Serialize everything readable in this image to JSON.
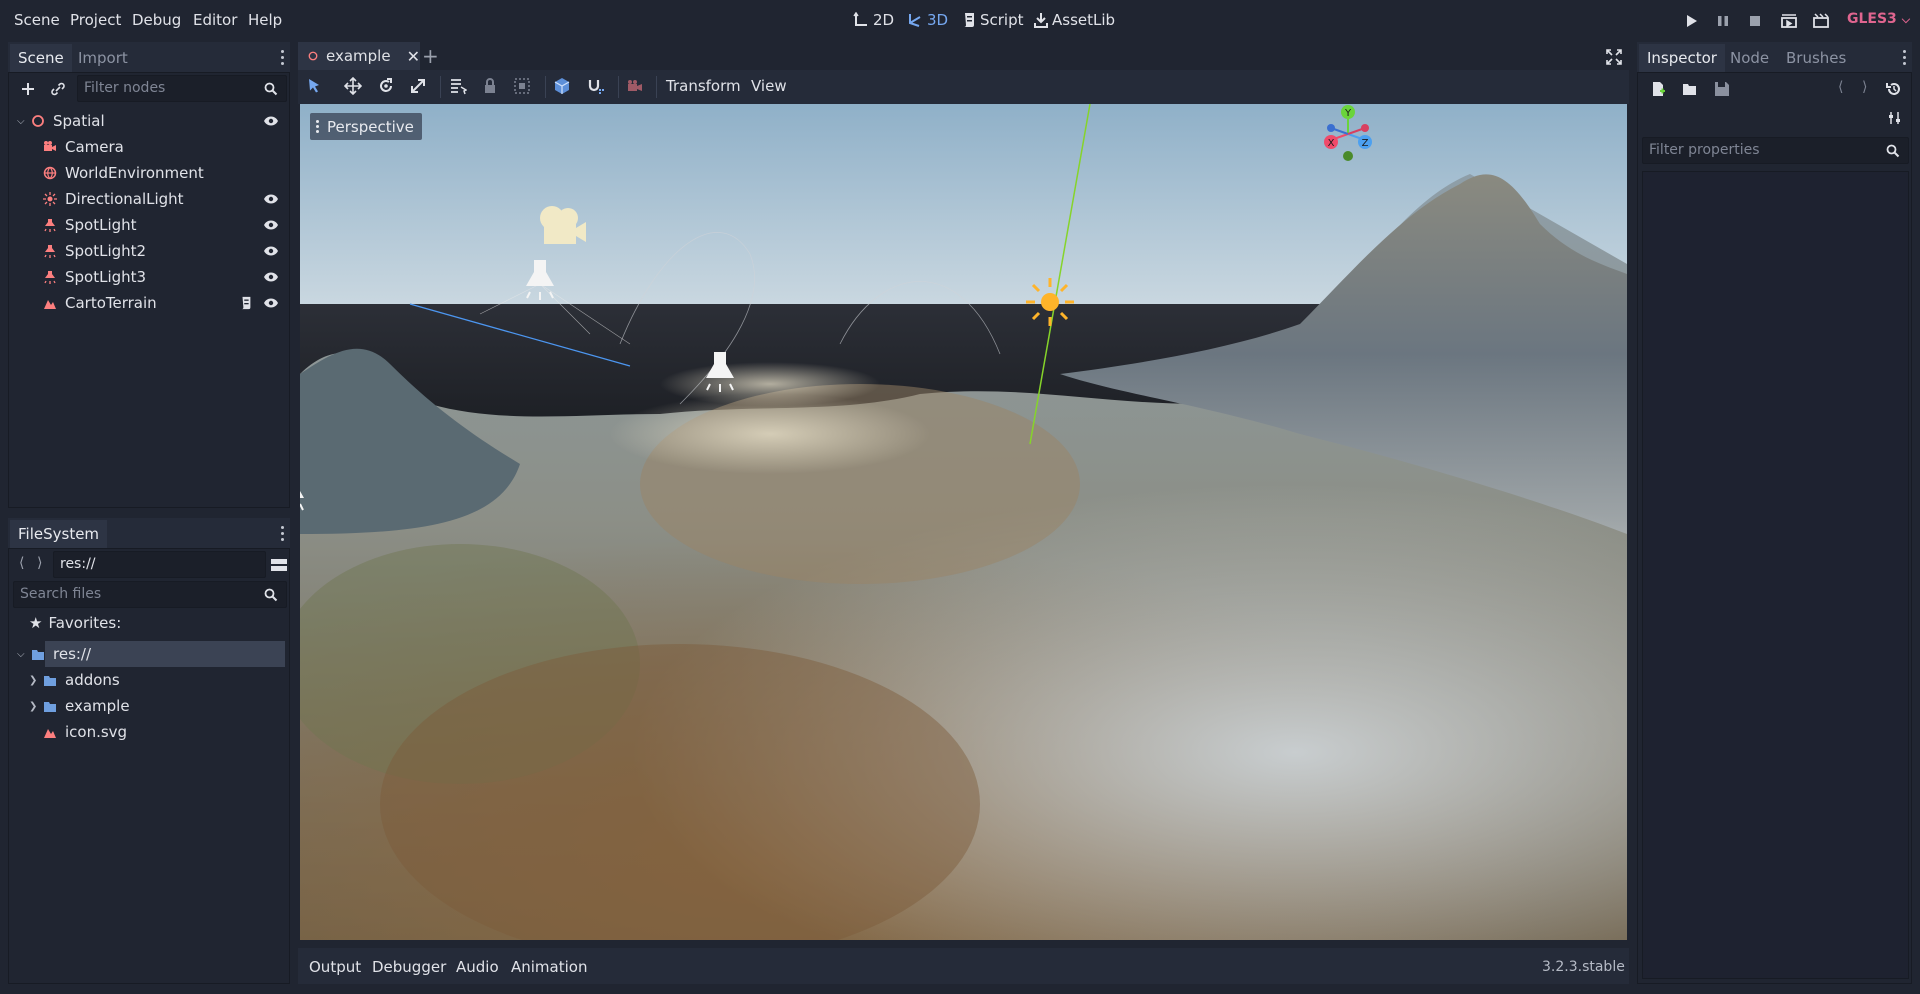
{
  "menu": {
    "scene": "Scene",
    "project": "Project",
    "debug": "Debug",
    "editor": "Editor",
    "help": "Help"
  },
  "workspaces": {
    "w2d": "2D",
    "w3d": "3D",
    "script": "Script",
    "assetlib": "AssetLib",
    "active": "3D"
  },
  "renderer": "GLES3",
  "scene_dock": {
    "tabs": [
      "Scene",
      "Import"
    ],
    "filter_placeholder": "Filter nodes",
    "nodes": [
      {
        "label": "Spatial",
        "icon": "spatial-icon",
        "visible": true
      },
      {
        "label": "Camera",
        "icon": "camera-icon",
        "visible": false
      },
      {
        "label": "WorldEnvironment",
        "icon": "world-environment-icon",
        "visible": false
      },
      {
        "label": "DirectionalLight",
        "icon": "directional-light-icon",
        "visible": true
      },
      {
        "label": "SpotLight",
        "icon": "spotlight-icon",
        "visible": true
      },
      {
        "label": "SpotLight2",
        "icon": "spotlight-icon",
        "visible": true
      },
      {
        "label": "SpotLight3",
        "icon": "spotlight-icon",
        "visible": true
      },
      {
        "label": "CartoTerrain",
        "icon": "terrain-icon",
        "visible": true,
        "has_script": true
      }
    ]
  },
  "filesystem_dock": {
    "title": "FileSystem",
    "path": "res://",
    "search_placeholder": "Search files",
    "favorites_label": "Favorites:",
    "items": [
      {
        "label": "res://",
        "icon": "folder-icon",
        "selected": true
      },
      {
        "label": "addons",
        "icon": "folder-icon"
      },
      {
        "label": "example",
        "icon": "folder-icon"
      },
      {
        "label": "icon.svg",
        "icon": "terrain-icon"
      }
    ]
  },
  "editor_tabs": {
    "scene_tab": "example"
  },
  "viewport_toolbar": {
    "transform": "Transform",
    "view": "View"
  },
  "viewport": {
    "perspective_label": "Perspective",
    "gizmo_axes": {
      "y": "Y",
      "x": "X",
      "z": "Z"
    }
  },
  "inspector_dock": {
    "tabs": [
      "Inspector",
      "Node",
      "Brushes"
    ],
    "filter_placeholder": "Filter properties"
  },
  "bottom_panel": {
    "tabs": [
      "Output",
      "Debugger",
      "Audio",
      "Animation"
    ],
    "version": "3.2.3.stable"
  },
  "colors": {
    "accent": "#76a8f0",
    "renderer": "#e0658f",
    "node_icon": "#fc7f7f",
    "sun": "#ffb42a"
  }
}
